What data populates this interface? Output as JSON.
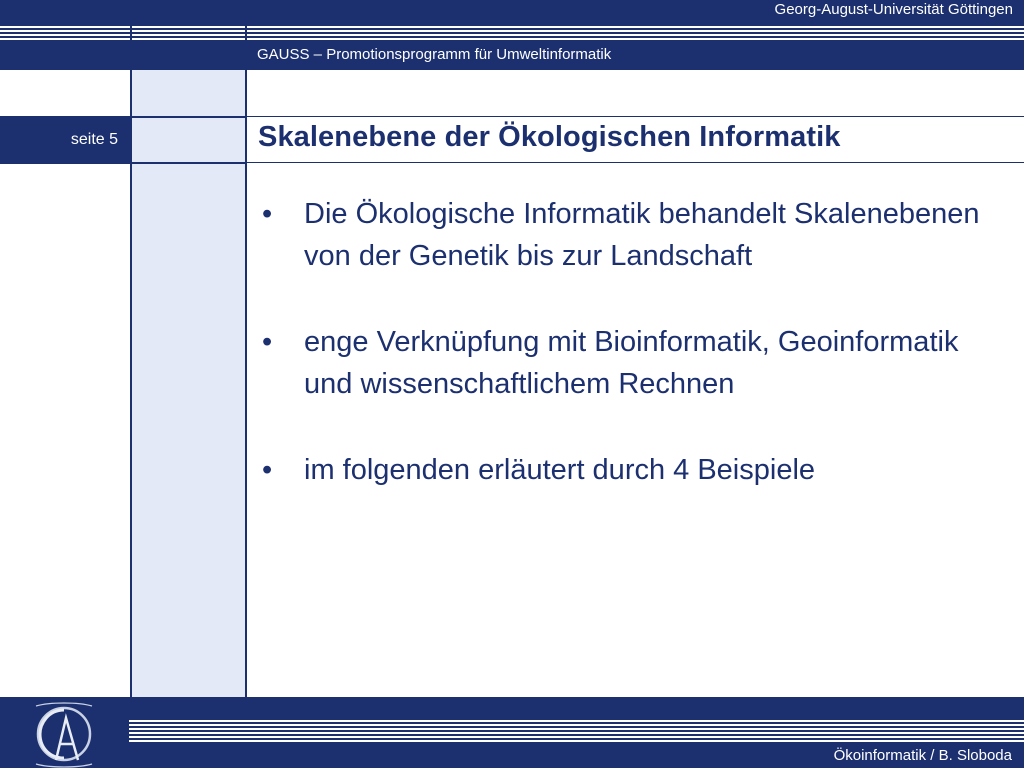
{
  "header": {
    "university": "Georg-August-Universität Göttingen",
    "program": "GAUSS – Promotionsprogramm für Umweltinformatik"
  },
  "slide": {
    "page_label": "seite 5",
    "title": "Skalenebene der Ökologischen Informatik",
    "bullet_marker": "•",
    "bullets": [
      "Die Ökologische Informatik behandelt Skalenebenen von der Genetik bis zur Landschaft",
      "enge Verknüpfung mit Bioinformatik, Geoinformatik und wissenschaftlichem Rechnen",
      "im folgenden erläutert durch 4 Beispiele"
    ]
  },
  "footer": {
    "author": "Ökoinformatik / B. Sloboda"
  },
  "logo": {
    "icon": "university-seal-icon",
    "letters": "GA"
  },
  "colors": {
    "navy": "#1c3070",
    "light_column": "#e3e9f6",
    "background": "#ffffff"
  }
}
